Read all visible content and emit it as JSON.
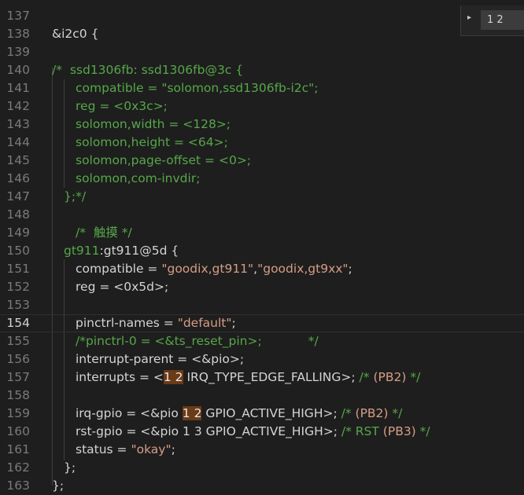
{
  "find_widget": {
    "query": "1 2",
    "toggle_glyph": "▸"
  },
  "lines": [
    {
      "n": "137",
      "indent": 0,
      "segs": []
    },
    {
      "n": "138",
      "indent": 0,
      "segs": [
        {
          "c": "t",
          "v": "&i2c0 {"
        }
      ]
    },
    {
      "n": "139",
      "indent": 0,
      "segs": []
    },
    {
      "n": "140",
      "indent": 0,
      "segs": [
        {
          "c": "c",
          "v": "/*  ssd1306fb: ssd1306fb@3c {"
        }
      ]
    },
    {
      "n": "141",
      "indent": 30,
      "segs": [
        {
          "c": "c",
          "v": "compatible = \"solomon,ssd1306fb-i2c\";"
        }
      ]
    },
    {
      "n": "142",
      "indent": 30,
      "segs": [
        {
          "c": "c",
          "v": "reg = <0x3c>;"
        }
      ]
    },
    {
      "n": "143",
      "indent": 30,
      "segs": [
        {
          "c": "c",
          "v": "solomon,width = <128>;"
        }
      ]
    },
    {
      "n": "144",
      "indent": 30,
      "segs": [
        {
          "c": "c",
          "v": "solomon,height = <64>;"
        }
      ]
    },
    {
      "n": "145",
      "indent": 30,
      "segs": [
        {
          "c": "c",
          "v": "solomon,page-offset = <0>;"
        }
      ]
    },
    {
      "n": "146",
      "indent": 30,
      "segs": [
        {
          "c": "c",
          "v": "solomon,com-invdir;"
        }
      ]
    },
    {
      "n": "147",
      "indent": 15,
      "segs": [
        {
          "c": "c",
          "v": "};*/"
        }
      ]
    },
    {
      "n": "148",
      "indent": 0,
      "segs": []
    },
    {
      "n": "149",
      "indent": 30,
      "segs": [
        {
          "c": "c",
          "v": "/*  触摸 */"
        }
      ]
    },
    {
      "n": "150",
      "indent": 15,
      "segs": [
        {
          "c": "g",
          "v": "gt911"
        },
        {
          "c": "t",
          "v": ":gt911@5d {"
        }
      ]
    },
    {
      "n": "151",
      "indent": 30,
      "segs": [
        {
          "c": "t",
          "v": "compatible = "
        },
        {
          "c": "s",
          "v": "\"goodix,gt911\""
        },
        {
          "c": "t",
          "v": ","
        },
        {
          "c": "s",
          "v": "\"goodix,gt9xx\""
        },
        {
          "c": "t",
          "v": ";"
        }
      ]
    },
    {
      "n": "152",
      "indent": 30,
      "segs": [
        {
          "c": "t",
          "v": "reg = <0x5d>;"
        }
      ]
    },
    {
      "n": "153",
      "indent": 0,
      "segs": []
    },
    {
      "n": "154",
      "indent": 30,
      "current": true,
      "segs": [
        {
          "c": "t",
          "v": "pinctrl-names = "
        },
        {
          "c": "s",
          "v": "\"default\""
        },
        {
          "c": "t",
          "v": ";"
        }
      ]
    },
    {
      "n": "155",
      "indent": 30,
      "segs": [
        {
          "c": "c",
          "v": "/*pinctrl-0 = <&ts_reset_pin>;            */"
        }
      ]
    },
    {
      "n": "156",
      "indent": 30,
      "segs": [
        {
          "c": "t",
          "v": "interrupt-parent = <&pio>;"
        }
      ]
    },
    {
      "n": "157",
      "indent": 30,
      "segs": [
        {
          "c": "t",
          "v": "interrupts = <"
        },
        {
          "c": "hl",
          "v": "1 2"
        },
        {
          "c": "t",
          "v": " IRQ_TYPE_EDGE_FALLING>; "
        },
        {
          "c": "c",
          "v": "/* "
        },
        {
          "c": "s",
          "v": "(PB2)"
        },
        {
          "c": "c",
          "v": " */"
        }
      ]
    },
    {
      "n": "158",
      "indent": 0,
      "segs": []
    },
    {
      "n": "159",
      "indent": 30,
      "segs": [
        {
          "c": "t",
          "v": "irq-gpio = <&pio "
        },
        {
          "c": "hl",
          "v": "1 2"
        },
        {
          "c": "t",
          "v": " GPIO_ACTIVE_HIGH>; "
        },
        {
          "c": "c",
          "v": "/* "
        },
        {
          "c": "s",
          "v": "(PB2)"
        },
        {
          "c": "c",
          "v": " */"
        }
      ]
    },
    {
      "n": "160",
      "indent": 30,
      "segs": [
        {
          "c": "t",
          "v": "rst-gpio = <&pio 1 3 GPIO_ACTIVE_HIGH>; "
        },
        {
          "c": "c",
          "v": "/* RST "
        },
        {
          "c": "s",
          "v": "(PB3)"
        },
        {
          "c": "c",
          "v": " */"
        }
      ]
    },
    {
      "n": "161",
      "indent": 30,
      "segs": [
        {
          "c": "t",
          "v": "status = "
        },
        {
          "c": "s",
          "v": "\"okay\""
        },
        {
          "c": "t",
          "v": ";"
        }
      ]
    },
    {
      "n": "162",
      "indent": 15,
      "segs": [
        {
          "c": "t",
          "v": "};"
        }
      ]
    },
    {
      "n": "163",
      "indent": 0,
      "segs": [
        {
          "c": "t",
          "v": "};"
        }
      ]
    }
  ]
}
